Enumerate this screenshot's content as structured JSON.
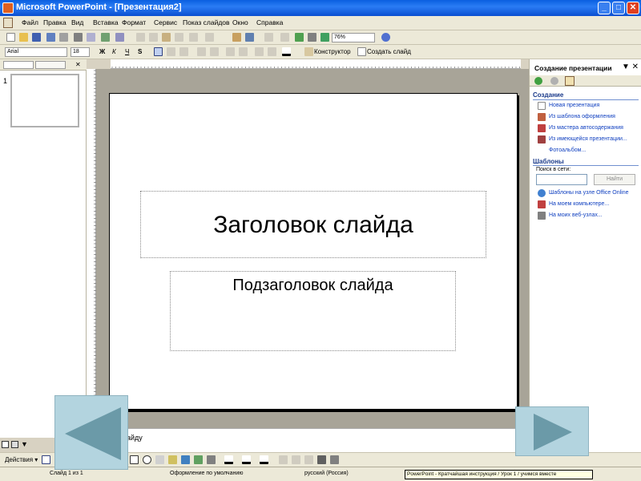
{
  "window": {
    "title": "Microsoft PowerPoint - [Презентация2]",
    "minimize": "_",
    "maximize": "□",
    "close": "✕"
  },
  "menu": {
    "items": [
      "Файл",
      "Правка",
      "Вид",
      "Вставка",
      "Формат",
      "Сервис",
      "Показ слайдов",
      "Окно",
      "Справка"
    ]
  },
  "toolbar": {
    "zoom": "76%",
    "font": "Arial",
    "font_size": "18",
    "bold": "Ж",
    "italic": "К",
    "underline": "Ч",
    "shadow": "S",
    "designer": "Конструктор",
    "new_slide": "Создать слайд"
  },
  "slides_pane": {
    "slide_number": "1"
  },
  "slide": {
    "title": "Заголовок слайда",
    "subtitle": "Подзаголовок слайда"
  },
  "notes": {
    "placeholder": "айду"
  },
  "task_pane": {
    "title": "Создание презентации",
    "close": "▼ ✕",
    "section_create": "Создание",
    "links_create": [
      "Новая презентация",
      "Из шаблона оформления",
      "Из мастера автосодержания",
      "Из имеющейся презентации...",
      "Фотоальбом..."
    ],
    "section_templates": "Шаблоны",
    "search_label": "Поиск в сети:",
    "search_button": "Найти",
    "links_templates": [
      "Шаблоны на узле Office Online",
      "На моем компьютере...",
      "На моих веб-узлах..."
    ]
  },
  "drawing_toolbar": {
    "actions": "Действия ▾"
  },
  "status": {
    "slide": "Слайд 1 из 1",
    "design": "Оформление по умолчанию",
    "language": "русский (Россия)",
    "tooltip": "PowerPoint - Кратчайшая инструкция / Урок 1 / учимся вместе"
  },
  "colors": {
    "titlebar": "#0a5fe0",
    "chrome": "#ece9d8",
    "nav_arrow": "#b3d4df",
    "nav_arrow_glyph": "#6b9aa8",
    "link": "#1040c0"
  }
}
